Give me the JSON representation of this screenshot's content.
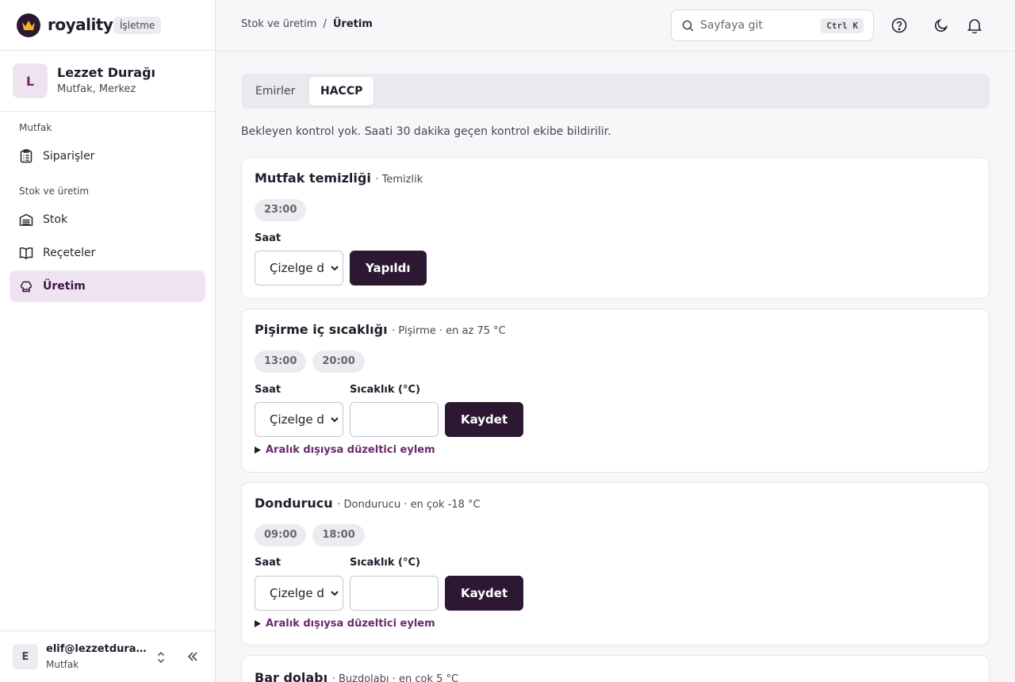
{
  "brand": {
    "name": "royality",
    "badge": "İşletme"
  },
  "org": {
    "initial": "L",
    "name": "Lezzet Durağı",
    "subtitle": "Mutfak, Merkez"
  },
  "nav": {
    "sections": [
      {
        "title": "Mutfak",
        "items": [
          {
            "label": "Siparişler",
            "icon": "clipboard-icon"
          }
        ]
      },
      {
        "title": "Stok ve üretim",
        "items": [
          {
            "label": "Stok",
            "icon": "warehouse-icon"
          },
          {
            "label": "Reçeteler",
            "icon": "book-icon"
          },
          {
            "label": "Üretim",
            "icon": "chef-hat-icon",
            "active": true
          }
        ]
      }
    ]
  },
  "user": {
    "initial": "E",
    "email": "elif@lezzetduragi.com",
    "role": "Mutfak"
  },
  "breadcrumb": {
    "parent": "Stok ve üretim",
    "separator": "/",
    "current": "Üretim"
  },
  "search": {
    "placeholder": "Sayfaya git",
    "shortcut": "Ctrl K"
  },
  "tabs": [
    {
      "label": "Emirler"
    },
    {
      "label": "HACCP",
      "active": true
    }
  ],
  "notice": "Bekleyen kontrol yok. Saati 30 dakika geçen kontrol ekibe bildirilir.",
  "cards": [
    {
      "title": "Mutfak temizliği",
      "meta": "· Temizlik",
      "times": [
        "23:00"
      ],
      "hour_label": "Saat",
      "select_value": "Çizelge d",
      "button": "Yapıldı"
    },
    {
      "title": "Pişirme iç sıcaklığı",
      "meta": "· Pişirme · en az 75 °C",
      "times": [
        "13:00",
        "20:00"
      ],
      "hour_label": "Saat",
      "temp_label": "Sıcaklık (°C)",
      "select_value": "Çizelge d",
      "button": "Kaydet",
      "details": "Aralık dışıysa düzeltici eylem"
    },
    {
      "title": "Dondurucu",
      "meta": "· Dondurucu · en çok -18 °C",
      "times": [
        "09:00",
        "18:00"
      ],
      "hour_label": "Saat",
      "temp_label": "Sıcaklık (°C)",
      "select_value": "Çizelge d",
      "button": "Kaydet",
      "details": "Aralık dışıysa düzeltici eylem"
    },
    {
      "title": "Bar dolabı",
      "meta": "· Buzdolabı · en çok 5 °C"
    }
  ],
  "colors": {
    "accent": "#2d1834",
    "active_bg": "#efe3f1",
    "link": "#6b2a6e"
  }
}
